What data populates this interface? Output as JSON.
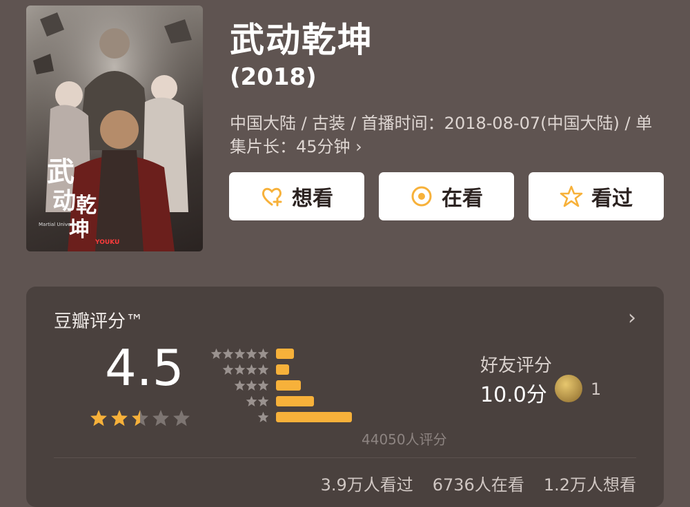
{
  "movie": {
    "title": "武动乾坤",
    "year": "(2018)",
    "meta": "中国大陆 / 古装 / 首播时间：2018-08-07(中国大陆) / 单集片长：45分钟 ›",
    "poster": {
      "title_glyphs": "武动乾坤",
      "subtitle": "Martial Universe",
      "brand": "YOUKU"
    }
  },
  "actions": [
    {
      "label": "想看",
      "icon": "heart-plus-icon"
    },
    {
      "label": "在看",
      "icon": "circle-dot-icon"
    },
    {
      "label": "看过",
      "icon": "star-outline-icon"
    }
  ],
  "rating": {
    "title": "豆瓣评分™",
    "score": "4.5",
    "stars": 2.5,
    "distribution": [
      {
        "stars": 5,
        "fraction": 0.24
      },
      {
        "stars": 4,
        "fraction": 0.17
      },
      {
        "stars": 3,
        "fraction": 0.33
      },
      {
        "stars": 2,
        "fraction": 0.5
      },
      {
        "stars": 1,
        "fraction": 1.0
      }
    ],
    "count": "44050人评分",
    "friend_label": "好友评分",
    "friend_score": "10.0分",
    "friend_count": "1",
    "stats": [
      "3.9万人看过",
      "6736人在看",
      "1.2万人想看"
    ]
  },
  "colors": {
    "accent": "#f7b13a",
    "background": "#5f5451",
    "card": "#4a413e"
  }
}
